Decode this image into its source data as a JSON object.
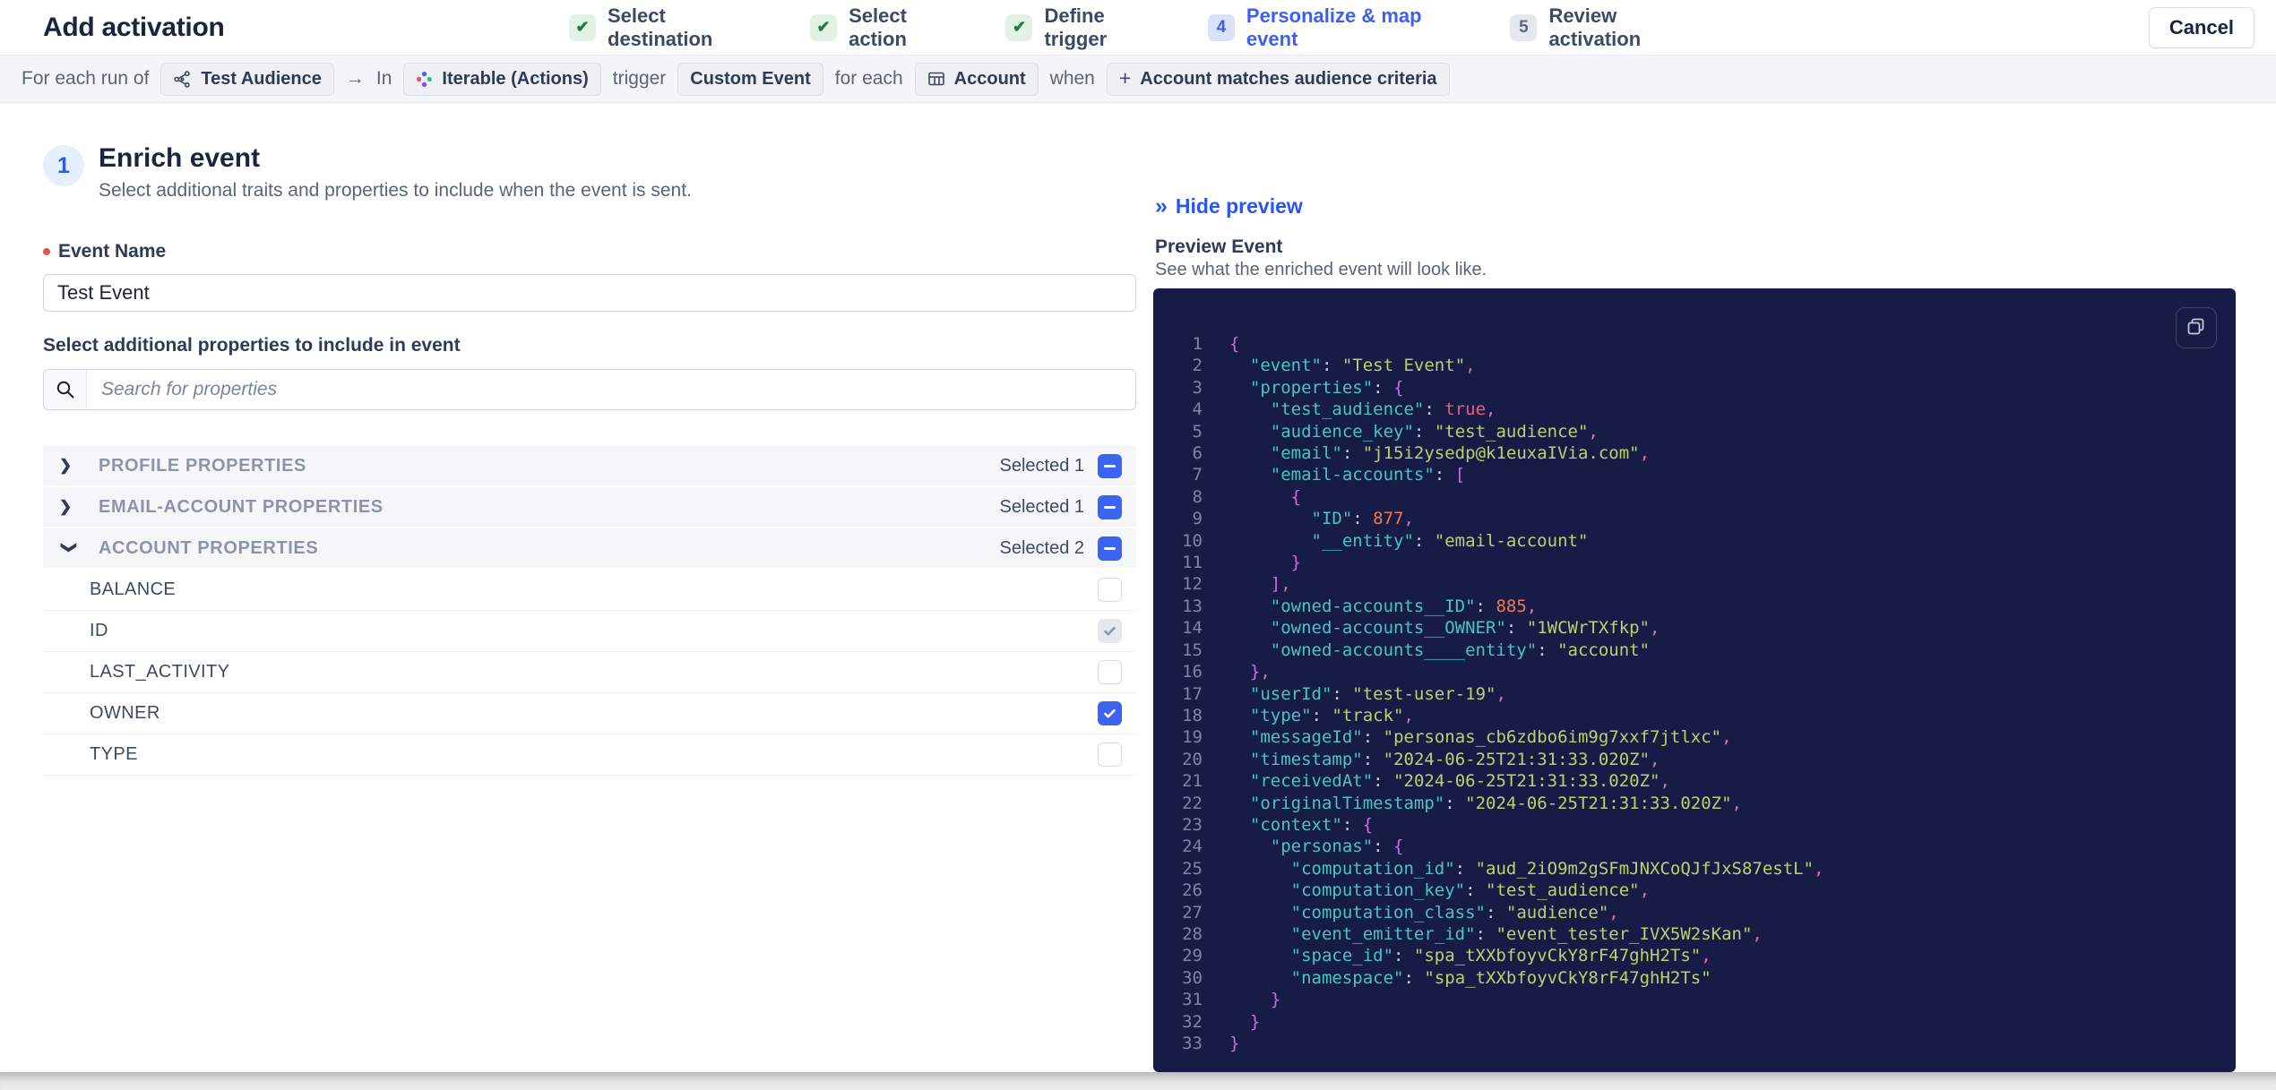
{
  "header": {
    "title": "Add activation",
    "cancel_label": "Cancel",
    "steps": [
      {
        "label": "Select destination",
        "state": "done"
      },
      {
        "label": "Select action",
        "state": "done"
      },
      {
        "label": "Define trigger",
        "state": "done"
      },
      {
        "label": "Personalize & map event",
        "state": "active",
        "number": "4"
      },
      {
        "label": "Review activation",
        "state": "todo",
        "number": "5"
      }
    ],
    "check_glyph": "✔"
  },
  "trigger_bar": {
    "segments": [
      {
        "type": "text",
        "text": "For each run of"
      },
      {
        "type": "chip",
        "icon": "audience-icon",
        "label": "Test Audience"
      },
      {
        "type": "text",
        "text": "→",
        "name": "arrow-icon"
      },
      {
        "type": "text",
        "text": "In"
      },
      {
        "type": "chip",
        "icon": "iterable-logo",
        "label": "Iterable (Actions)"
      },
      {
        "type": "text",
        "text": "trigger"
      },
      {
        "type": "chip",
        "label": "Custom Event"
      },
      {
        "type": "text",
        "text": "for each"
      },
      {
        "type": "chip",
        "icon": "table-icon",
        "label": "Account"
      },
      {
        "type": "text",
        "text": "when"
      },
      {
        "type": "chip",
        "icon": "plus-icon",
        "label": "Account matches audience criteria"
      }
    ]
  },
  "enrich": {
    "step_number": "1",
    "title": "Enrich event",
    "subtitle": "Select additional traits and properties to include when the event is sent.",
    "event_name_label": "Event Name",
    "event_name_value": "Test Event",
    "properties_label": "Select additional properties to include in event",
    "search_placeholder": "Search for properties",
    "sections": [
      {
        "label": "PROFILE PROPERTIES",
        "selected_text": "Selected 1",
        "expanded": false,
        "items": []
      },
      {
        "label": "EMAIL-ACCOUNT PROPERTIES",
        "selected_text": "Selected 1",
        "expanded": false,
        "items": []
      },
      {
        "label": "ACCOUNT PROPERTIES",
        "selected_text": "Selected 2",
        "expanded": true,
        "items": [
          {
            "label": "BALANCE",
            "checkbox": "unchecked"
          },
          {
            "label": "ID",
            "checkbox": "checked-disabled"
          },
          {
            "label": "LAST_ACTIVITY",
            "checkbox": "unchecked"
          },
          {
            "label": "OWNER",
            "checkbox": "checked"
          },
          {
            "label": "TYPE",
            "checkbox": "unchecked"
          }
        ]
      }
    ]
  },
  "preview": {
    "hide_label": "Hide preview",
    "hide_chevrons": "»",
    "title": "Preview Event",
    "subtitle": "See what the enriched event will look like.",
    "code_lines": [
      {
        "n": 1,
        "i": 0,
        "t": [
          [
            "br",
            "{"
          ]
        ]
      },
      {
        "n": 2,
        "i": 2,
        "t": [
          [
            "key",
            "\"event\""
          ],
          [
            "pun",
            ": "
          ],
          [
            "str",
            "\"Test Event\""
          ],
          [
            "com",
            ","
          ]
        ]
      },
      {
        "n": 3,
        "i": 2,
        "t": [
          [
            "key",
            "\"properties\""
          ],
          [
            "pun",
            ": "
          ],
          [
            "br",
            "{"
          ]
        ]
      },
      {
        "n": 4,
        "i": 4,
        "t": [
          [
            "key",
            "\"test_audience\""
          ],
          [
            "pun",
            ": "
          ],
          [
            "bool",
            "true"
          ],
          [
            "com",
            ","
          ]
        ]
      },
      {
        "n": 5,
        "i": 4,
        "t": [
          [
            "key",
            "\"audience_key\""
          ],
          [
            "pun",
            ": "
          ],
          [
            "str",
            "\"test_audience\""
          ],
          [
            "com",
            ","
          ]
        ]
      },
      {
        "n": 6,
        "i": 4,
        "t": [
          [
            "key",
            "\"email\""
          ],
          [
            "pun",
            ": "
          ],
          [
            "str",
            "\"j15i2ysedp@k1euxaIVia.com\""
          ],
          [
            "com",
            ","
          ]
        ]
      },
      {
        "n": 7,
        "i": 4,
        "t": [
          [
            "key",
            "\"email-accounts\""
          ],
          [
            "pun",
            ": "
          ],
          [
            "br",
            "["
          ]
        ]
      },
      {
        "n": 8,
        "i": 6,
        "t": [
          [
            "br",
            "{"
          ]
        ]
      },
      {
        "n": 9,
        "i": 8,
        "t": [
          [
            "key",
            "\"ID\""
          ],
          [
            "pun",
            ": "
          ],
          [
            "num",
            "877"
          ],
          [
            "com",
            ","
          ]
        ]
      },
      {
        "n": 10,
        "i": 8,
        "t": [
          [
            "key",
            "\"__entity\""
          ],
          [
            "pun",
            ": "
          ],
          [
            "str",
            "\"email-account\""
          ]
        ]
      },
      {
        "n": 11,
        "i": 6,
        "t": [
          [
            "br",
            "}"
          ]
        ]
      },
      {
        "n": 12,
        "i": 4,
        "t": [
          [
            "br",
            "]"
          ],
          [
            "com",
            ","
          ]
        ]
      },
      {
        "n": 13,
        "i": 4,
        "t": [
          [
            "key",
            "\"owned-accounts__ID\""
          ],
          [
            "pun",
            ": "
          ],
          [
            "num",
            "885"
          ],
          [
            "com",
            ","
          ]
        ]
      },
      {
        "n": 14,
        "i": 4,
        "t": [
          [
            "key",
            "\"owned-accounts__OWNER\""
          ],
          [
            "pun",
            ": "
          ],
          [
            "str",
            "\"1WCWrTXfkp\""
          ],
          [
            "com",
            ","
          ]
        ]
      },
      {
        "n": 15,
        "i": 4,
        "t": [
          [
            "key",
            "\"owned-accounts____entity\""
          ],
          [
            "pun",
            ": "
          ],
          [
            "str",
            "\"account\""
          ]
        ]
      },
      {
        "n": 16,
        "i": 2,
        "t": [
          [
            "br",
            "}"
          ],
          [
            "com",
            ","
          ]
        ]
      },
      {
        "n": 17,
        "i": 2,
        "t": [
          [
            "key",
            "\"userId\""
          ],
          [
            "pun",
            ": "
          ],
          [
            "str",
            "\"test-user-19\""
          ],
          [
            "com",
            ","
          ]
        ]
      },
      {
        "n": 18,
        "i": 2,
        "t": [
          [
            "key",
            "\"type\""
          ],
          [
            "pun",
            ": "
          ],
          [
            "str",
            "\"track\""
          ],
          [
            "com",
            ","
          ]
        ]
      },
      {
        "n": 19,
        "i": 2,
        "t": [
          [
            "key",
            "\"messageId\""
          ],
          [
            "pun",
            ": "
          ],
          [
            "str",
            "\"personas_cb6zdbo6im9g7xxf7jtlxc\""
          ],
          [
            "com",
            ","
          ]
        ]
      },
      {
        "n": 20,
        "i": 2,
        "t": [
          [
            "key",
            "\"timestamp\""
          ],
          [
            "pun",
            ": "
          ],
          [
            "str",
            "\"2024-06-25T21:31:33.020Z\""
          ],
          [
            "com",
            ","
          ]
        ]
      },
      {
        "n": 21,
        "i": 2,
        "t": [
          [
            "key",
            "\"receivedAt\""
          ],
          [
            "pun",
            ": "
          ],
          [
            "str",
            "\"2024-06-25T21:31:33.020Z\""
          ],
          [
            "com",
            ","
          ]
        ]
      },
      {
        "n": 22,
        "i": 2,
        "t": [
          [
            "key",
            "\"originalTimestamp\""
          ],
          [
            "pun",
            ": "
          ],
          [
            "str",
            "\"2024-06-25T21:31:33.020Z\""
          ],
          [
            "com",
            ","
          ]
        ]
      },
      {
        "n": 23,
        "i": 2,
        "t": [
          [
            "key",
            "\"context\""
          ],
          [
            "pun",
            ": "
          ],
          [
            "br",
            "{"
          ]
        ]
      },
      {
        "n": 24,
        "i": 4,
        "t": [
          [
            "key",
            "\"personas\""
          ],
          [
            "pun",
            ": "
          ],
          [
            "br",
            "{"
          ]
        ]
      },
      {
        "n": 25,
        "i": 6,
        "t": [
          [
            "key",
            "\"computation_id\""
          ],
          [
            "pun",
            ": "
          ],
          [
            "str",
            "\"aud_2iO9m2gSFmJNXCoQJfJxS87estL\""
          ],
          [
            "com",
            ","
          ]
        ]
      },
      {
        "n": 26,
        "i": 6,
        "t": [
          [
            "key",
            "\"computation_key\""
          ],
          [
            "pun",
            ": "
          ],
          [
            "str",
            "\"test_audience\""
          ],
          [
            "com",
            ","
          ]
        ]
      },
      {
        "n": 27,
        "i": 6,
        "t": [
          [
            "key",
            "\"computation_class\""
          ],
          [
            "pun",
            ": "
          ],
          [
            "str",
            "\"audience\""
          ],
          [
            "com",
            ","
          ]
        ]
      },
      {
        "n": 28,
        "i": 6,
        "t": [
          [
            "key",
            "\"event_emitter_id\""
          ],
          [
            "pun",
            ": "
          ],
          [
            "str",
            "\"event_tester_IVX5W2sKan\""
          ],
          [
            "com",
            ","
          ]
        ]
      },
      {
        "n": 29,
        "i": 6,
        "t": [
          [
            "key",
            "\"space_id\""
          ],
          [
            "pun",
            ": "
          ],
          [
            "str",
            "\"spa_tXXbfoyvCkY8rF47ghH2Ts\""
          ],
          [
            "com",
            ","
          ]
        ]
      },
      {
        "n": 30,
        "i": 6,
        "t": [
          [
            "key",
            "\"namespace\""
          ],
          [
            "pun",
            ": "
          ],
          [
            "str",
            "\"spa_tXXbfoyvCkY8rF47ghH2Ts\""
          ]
        ]
      },
      {
        "n": 31,
        "i": 4,
        "t": [
          [
            "br",
            "}"
          ]
        ]
      },
      {
        "n": 32,
        "i": 2,
        "t": [
          [
            "br",
            "}"
          ]
        ]
      },
      {
        "n": 33,
        "i": 0,
        "t": [
          [
            "br",
            "}"
          ]
        ]
      }
    ]
  },
  "colors": {
    "accent_blue": "#3c5ef5",
    "checkbox_blue": "#3d63f2",
    "success_green": "#217a46",
    "code_bg": "#171c47",
    "code_key": "#4cc3c3",
    "code_string": "#b9d36c",
    "code_number": "#ee7a52",
    "code_boolean": "#ee5d76",
    "code_comma": "#d673a8",
    "code_bracket": "#c96fd6"
  }
}
